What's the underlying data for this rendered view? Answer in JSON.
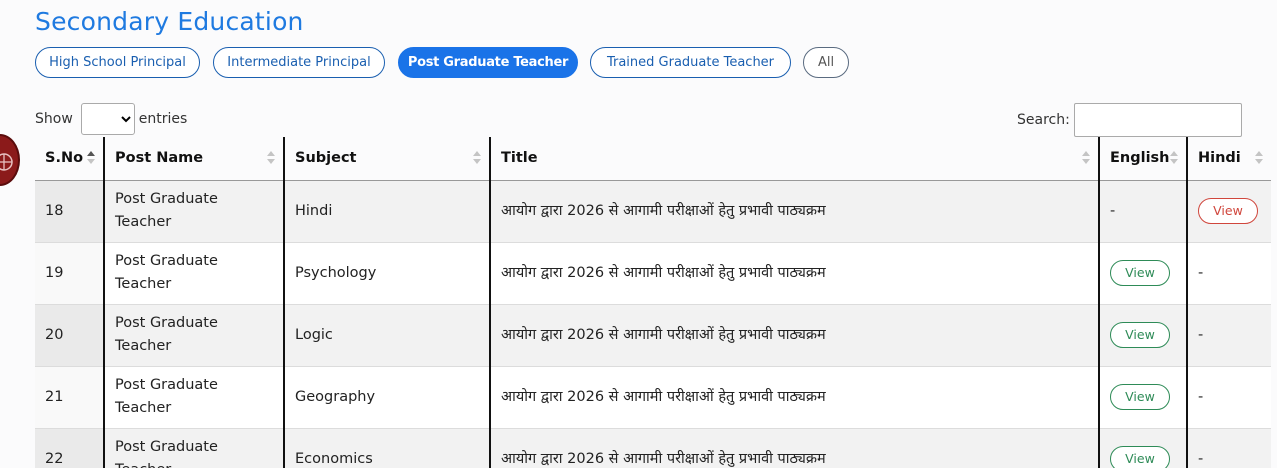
{
  "page": {
    "heading": "Secondary Education"
  },
  "filters": [
    {
      "label": "High School Principal",
      "active": false
    },
    {
      "label": "Intermediate Principal",
      "active": false
    },
    {
      "label": "Post Graduate Teacher",
      "active": true
    },
    {
      "label": "Trained Graduate Teacher",
      "active": false
    },
    {
      "label": "All",
      "active": false
    }
  ],
  "controls": {
    "show_label": "Show",
    "entries_label": "entries",
    "entries_value": "",
    "search_label": "Search:",
    "search_value": ""
  },
  "table": {
    "columns": [
      "S.No",
      "Post Name",
      "Subject",
      "Title",
      "English",
      "Hindi"
    ],
    "sorted_column": "S.No",
    "sort_direction": "ascending",
    "rows": [
      {
        "sno": "18",
        "post": "Post Graduate Teacher",
        "subject": "Hindi",
        "title": "आयोग द्वारा 2026 से आगामी परीक्षाओं हेतु प्रभावी पाठ्यक्रम",
        "english": "-",
        "hindi": "View"
      },
      {
        "sno": "19",
        "post": "Post Graduate Teacher",
        "subject": "Psychology",
        "title": "आयोग द्वारा 2026 से आगामी परीक्षाओं हेतु प्रभावी पाठ्यक्रम",
        "english": "View",
        "hindi": "-"
      },
      {
        "sno": "20",
        "post": "Post Graduate Teacher",
        "subject": "Logic",
        "title": "आयोग द्वारा 2026 से आगामी परीक्षाओं हेतु प्रभावी पाठ्यक्रम",
        "english": "View",
        "hindi": "-"
      },
      {
        "sno": "21",
        "post": "Post Graduate Teacher",
        "subject": "Geography",
        "title": "आयोग द्वारा 2026 से आगामी परीक्षाओं हेतु प्रभावी पाठ्यक्रम",
        "english": "View",
        "hindi": "-"
      },
      {
        "sno": "22",
        "post": "Post Graduate Teacher",
        "subject": "Economics",
        "title": "आयोग द्वारा 2026 से आगामी परीक्षाओं हेतु प्रभावी पाठ्यक्रम",
        "english": "View",
        "hindi": "-"
      }
    ]
  },
  "colors": {
    "heading": "#1f7ae0",
    "pill_active_bg": "#1a73e8",
    "view_english": "#2e8b57",
    "view_hindi": "#d0463c",
    "emblem": "#8b1a1a"
  },
  "icons": {
    "emblem": "emblem-icon",
    "sort": "sort-icon"
  }
}
